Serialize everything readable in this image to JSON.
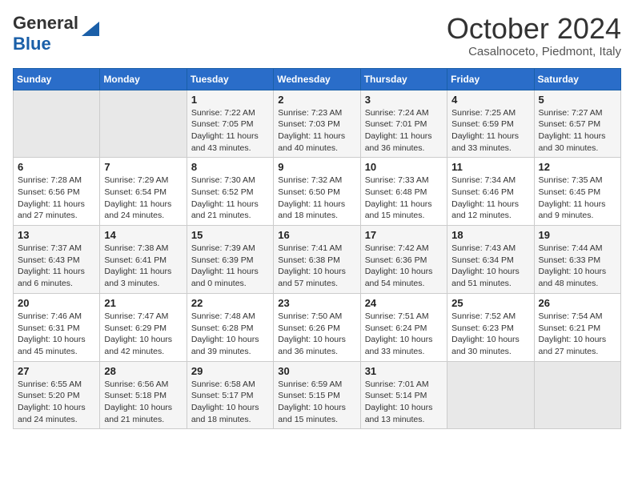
{
  "header": {
    "logo_general": "General",
    "logo_blue": "Blue",
    "month_title": "October 2024",
    "location": "Casalnoceto, Piedmont, Italy"
  },
  "days_of_week": [
    "Sunday",
    "Monday",
    "Tuesday",
    "Wednesday",
    "Thursday",
    "Friday",
    "Saturday"
  ],
  "weeks": [
    [
      {
        "day": "",
        "info": ""
      },
      {
        "day": "",
        "info": ""
      },
      {
        "day": "1",
        "info": "Sunrise: 7:22 AM\nSunset: 7:05 PM\nDaylight: 11 hours and 43 minutes."
      },
      {
        "day": "2",
        "info": "Sunrise: 7:23 AM\nSunset: 7:03 PM\nDaylight: 11 hours and 40 minutes."
      },
      {
        "day": "3",
        "info": "Sunrise: 7:24 AM\nSunset: 7:01 PM\nDaylight: 11 hours and 36 minutes."
      },
      {
        "day": "4",
        "info": "Sunrise: 7:25 AM\nSunset: 6:59 PM\nDaylight: 11 hours and 33 minutes."
      },
      {
        "day": "5",
        "info": "Sunrise: 7:27 AM\nSunset: 6:57 PM\nDaylight: 11 hours and 30 minutes."
      }
    ],
    [
      {
        "day": "6",
        "info": "Sunrise: 7:28 AM\nSunset: 6:56 PM\nDaylight: 11 hours and 27 minutes."
      },
      {
        "day": "7",
        "info": "Sunrise: 7:29 AM\nSunset: 6:54 PM\nDaylight: 11 hours and 24 minutes."
      },
      {
        "day": "8",
        "info": "Sunrise: 7:30 AM\nSunset: 6:52 PM\nDaylight: 11 hours and 21 minutes."
      },
      {
        "day": "9",
        "info": "Sunrise: 7:32 AM\nSunset: 6:50 PM\nDaylight: 11 hours and 18 minutes."
      },
      {
        "day": "10",
        "info": "Sunrise: 7:33 AM\nSunset: 6:48 PM\nDaylight: 11 hours and 15 minutes."
      },
      {
        "day": "11",
        "info": "Sunrise: 7:34 AM\nSunset: 6:46 PM\nDaylight: 11 hours and 12 minutes."
      },
      {
        "day": "12",
        "info": "Sunrise: 7:35 AM\nSunset: 6:45 PM\nDaylight: 11 hours and 9 minutes."
      }
    ],
    [
      {
        "day": "13",
        "info": "Sunrise: 7:37 AM\nSunset: 6:43 PM\nDaylight: 11 hours and 6 minutes."
      },
      {
        "day": "14",
        "info": "Sunrise: 7:38 AM\nSunset: 6:41 PM\nDaylight: 11 hours and 3 minutes."
      },
      {
        "day": "15",
        "info": "Sunrise: 7:39 AM\nSunset: 6:39 PM\nDaylight: 11 hours and 0 minutes."
      },
      {
        "day": "16",
        "info": "Sunrise: 7:41 AM\nSunset: 6:38 PM\nDaylight: 10 hours and 57 minutes."
      },
      {
        "day": "17",
        "info": "Sunrise: 7:42 AM\nSunset: 6:36 PM\nDaylight: 10 hours and 54 minutes."
      },
      {
        "day": "18",
        "info": "Sunrise: 7:43 AM\nSunset: 6:34 PM\nDaylight: 10 hours and 51 minutes."
      },
      {
        "day": "19",
        "info": "Sunrise: 7:44 AM\nSunset: 6:33 PM\nDaylight: 10 hours and 48 minutes."
      }
    ],
    [
      {
        "day": "20",
        "info": "Sunrise: 7:46 AM\nSunset: 6:31 PM\nDaylight: 10 hours and 45 minutes."
      },
      {
        "day": "21",
        "info": "Sunrise: 7:47 AM\nSunset: 6:29 PM\nDaylight: 10 hours and 42 minutes."
      },
      {
        "day": "22",
        "info": "Sunrise: 7:48 AM\nSunset: 6:28 PM\nDaylight: 10 hours and 39 minutes."
      },
      {
        "day": "23",
        "info": "Sunrise: 7:50 AM\nSunset: 6:26 PM\nDaylight: 10 hours and 36 minutes."
      },
      {
        "day": "24",
        "info": "Sunrise: 7:51 AM\nSunset: 6:24 PM\nDaylight: 10 hours and 33 minutes."
      },
      {
        "day": "25",
        "info": "Sunrise: 7:52 AM\nSunset: 6:23 PM\nDaylight: 10 hours and 30 minutes."
      },
      {
        "day": "26",
        "info": "Sunrise: 7:54 AM\nSunset: 6:21 PM\nDaylight: 10 hours and 27 minutes."
      }
    ],
    [
      {
        "day": "27",
        "info": "Sunrise: 6:55 AM\nSunset: 5:20 PM\nDaylight: 10 hours and 24 minutes."
      },
      {
        "day": "28",
        "info": "Sunrise: 6:56 AM\nSunset: 5:18 PM\nDaylight: 10 hours and 21 minutes."
      },
      {
        "day": "29",
        "info": "Sunrise: 6:58 AM\nSunset: 5:17 PM\nDaylight: 10 hours and 18 minutes."
      },
      {
        "day": "30",
        "info": "Sunrise: 6:59 AM\nSunset: 5:15 PM\nDaylight: 10 hours and 15 minutes."
      },
      {
        "day": "31",
        "info": "Sunrise: 7:01 AM\nSunset: 5:14 PM\nDaylight: 10 hours and 13 minutes."
      },
      {
        "day": "",
        "info": ""
      },
      {
        "day": "",
        "info": ""
      }
    ]
  ]
}
